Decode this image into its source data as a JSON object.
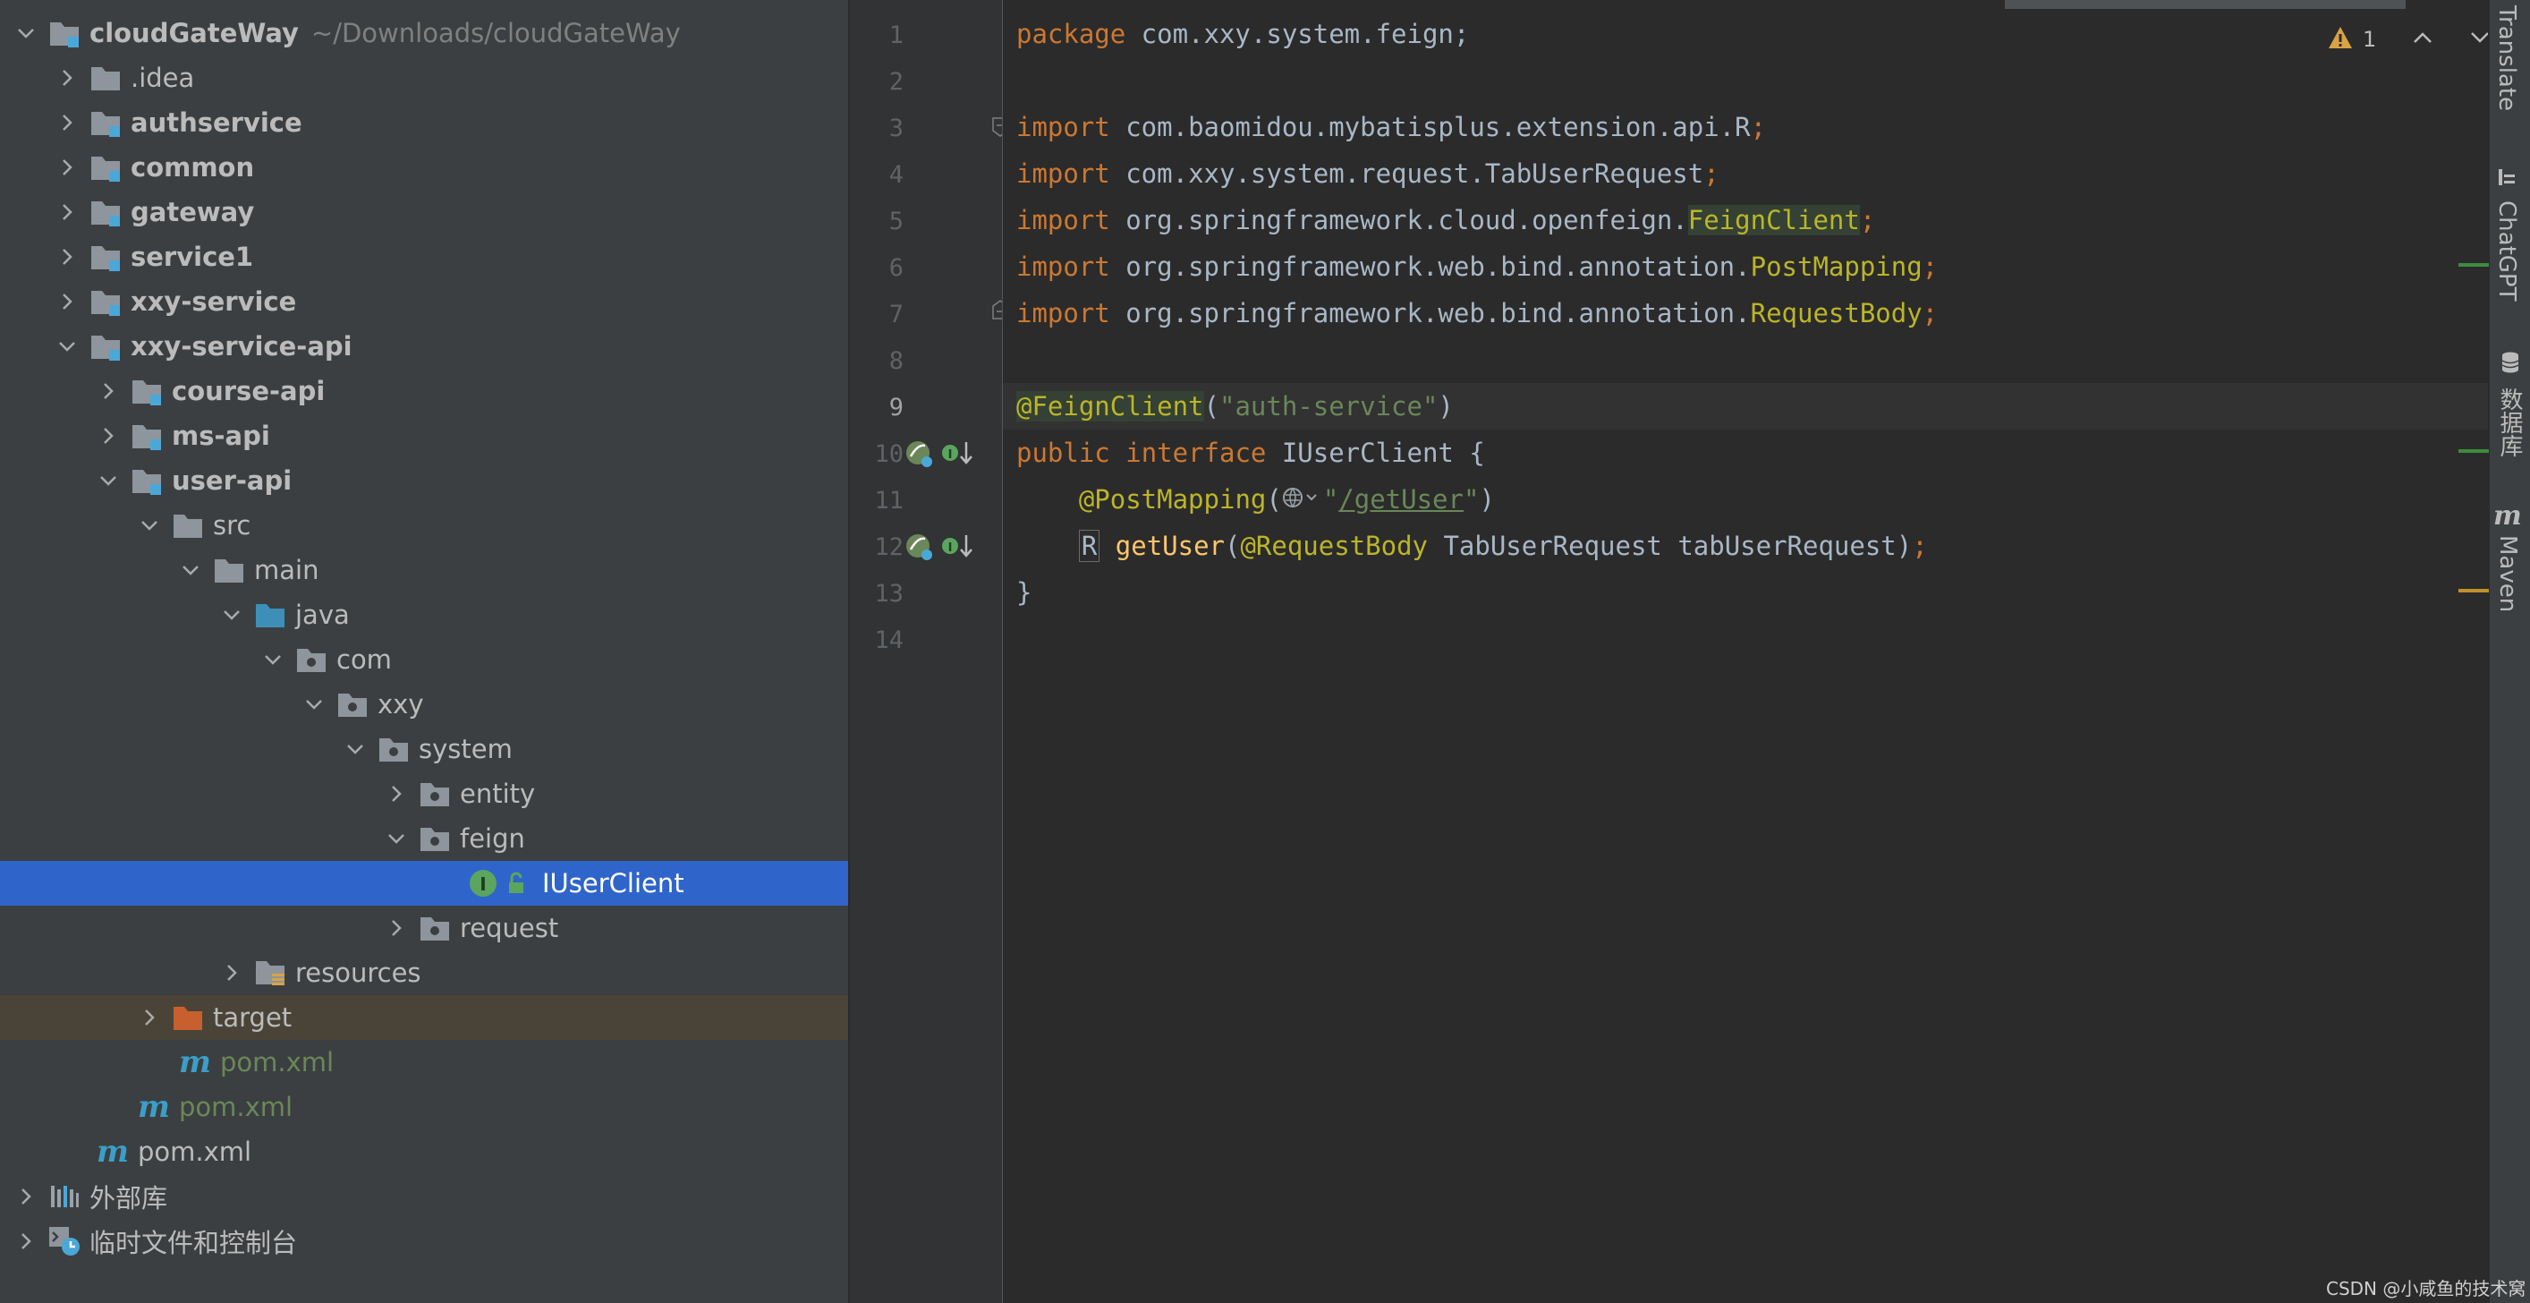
{
  "project_tree": {
    "rows": [
      {
        "label": "cloudGateWay",
        "path": "~/Downloads/cloudGateWay",
        "bold": true
      },
      {
        "label": ".idea"
      },
      {
        "label": "authservice",
        "bold": true
      },
      {
        "label": "common",
        "bold": true
      },
      {
        "label": "gateway",
        "bold": true
      },
      {
        "label": "service1",
        "bold": true
      },
      {
        "label": "xxy-service",
        "bold": true
      },
      {
        "label": "xxy-service-api",
        "bold": true
      },
      {
        "label": "course-api",
        "bold": true
      },
      {
        "label": "ms-api",
        "bold": true
      },
      {
        "label": "user-api",
        "bold": true
      },
      {
        "label": "src"
      },
      {
        "label": "main"
      },
      {
        "label": "java"
      },
      {
        "label": "com"
      },
      {
        "label": "xxy"
      },
      {
        "label": "system"
      },
      {
        "label": "entity"
      },
      {
        "label": "feign"
      },
      {
        "label": "IUserClient",
        "selected": true
      },
      {
        "label": "request"
      },
      {
        "label": "resources"
      },
      {
        "label": "target"
      },
      {
        "label": "pom.xml",
        "green": true
      },
      {
        "label": "pom.xml",
        "green": true
      },
      {
        "label": "pom.xml"
      },
      {
        "label": "外部库"
      },
      {
        "label": "临时文件和控制台"
      }
    ]
  },
  "editor": {
    "line_numbers": [
      "1",
      "2",
      "3",
      "4",
      "5",
      "6",
      "7",
      "8",
      "9",
      "10",
      "11",
      "12",
      "13",
      "14"
    ],
    "current_line": "9",
    "warning_count": "1",
    "code": {
      "l1_kw": "package",
      "l1_rest": " com.xxy.system.feign;",
      "import_kw": "import",
      "l3_rest": " com.baomidou.mybatisplus.extension.api.R",
      "l4_rest": " com.xxy.system.request.TabUserRequest",
      "l5_pre": " org.springframework.cloud.openfeign.",
      "l5_cls": "FeignClient",
      "l6_pre": " org.springframework.web.bind.annotation.",
      "l6_cls": "PostMapping",
      "l7_pre": " org.springframework.web.bind.annotation.",
      "l7_cls": "RequestBody",
      "semi": ";",
      "l9_ann": "@FeignClient",
      "l9_open": "(",
      "l9_str": "\"auth-service\"",
      "l9_close": ")",
      "l10_public": "public",
      "l10_interface": "interface",
      "l10_name": " IUserClient {",
      "l11_ann": "@PostMapping",
      "l11_open": "(",
      "l11_q1": "\"",
      "l11_path": "/getUser",
      "l11_q2": "\"",
      "l11_close": ")",
      "l12_r": "R",
      "l12_fn": "getUser",
      "l12_open": "(",
      "l12_ann": "@RequestBody",
      "l12_rest": " TabUserRequest tabUserRequest)",
      "l13": "}"
    }
  },
  "right_tools": {
    "translate": "Translate",
    "chatgpt": "ChatGPT",
    "database": "数据库",
    "maven": "Maven"
  },
  "watermark": "CSDN @小咸鱼的技术窝",
  "colors": {
    "selection": "#2f65ca",
    "keyword": "#cc7832",
    "annotation": "#bbb529",
    "string": "#6a8759",
    "method": "#ffc66d"
  }
}
